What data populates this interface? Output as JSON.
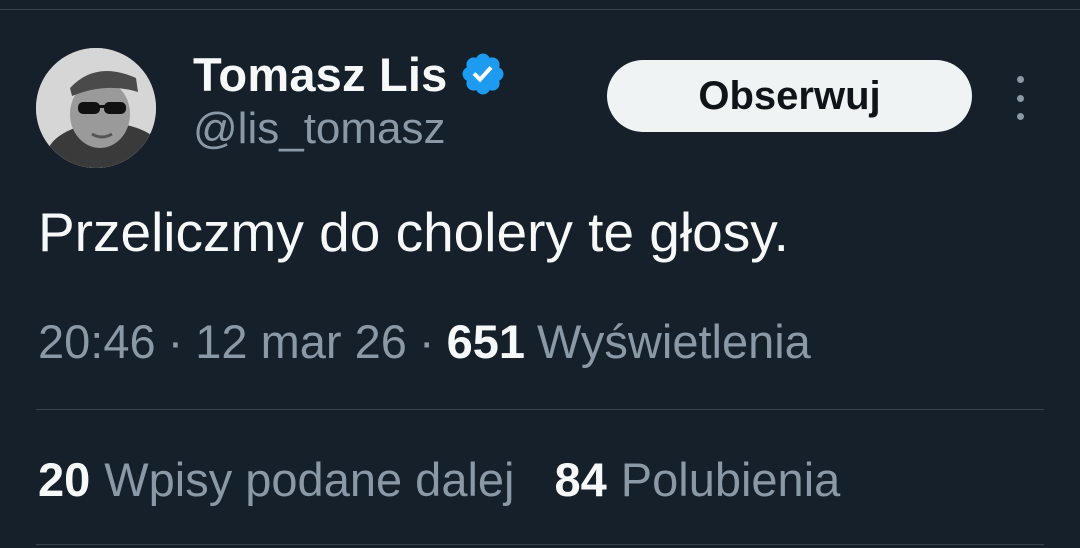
{
  "author": {
    "name": "Tomasz Lis",
    "handle": "@lis_tomasz",
    "verified": true
  },
  "follow_button": {
    "label": "Obserwuj"
  },
  "tweet": {
    "text": "Przeliczmy do cholery te głosy.",
    "time": "20:46",
    "separator": "·",
    "date": "12 mar 26",
    "views_count": "651",
    "views_label": "Wyświetlenia"
  },
  "stats": {
    "retweets_count": "20",
    "retweets_label": "Wpisy podane dalej",
    "likes_count": "84",
    "likes_label": "Polubienia"
  },
  "colors": {
    "background": "#15202b",
    "text_primary": "#f7f9f9",
    "text_secondary": "#8b98a5",
    "verified": "#1d9bf0",
    "divider": "#38444d",
    "button_bg": "#eff3f4"
  },
  "icons": {
    "verified": "verified-badge-icon",
    "more": "more-vertical-icon"
  }
}
